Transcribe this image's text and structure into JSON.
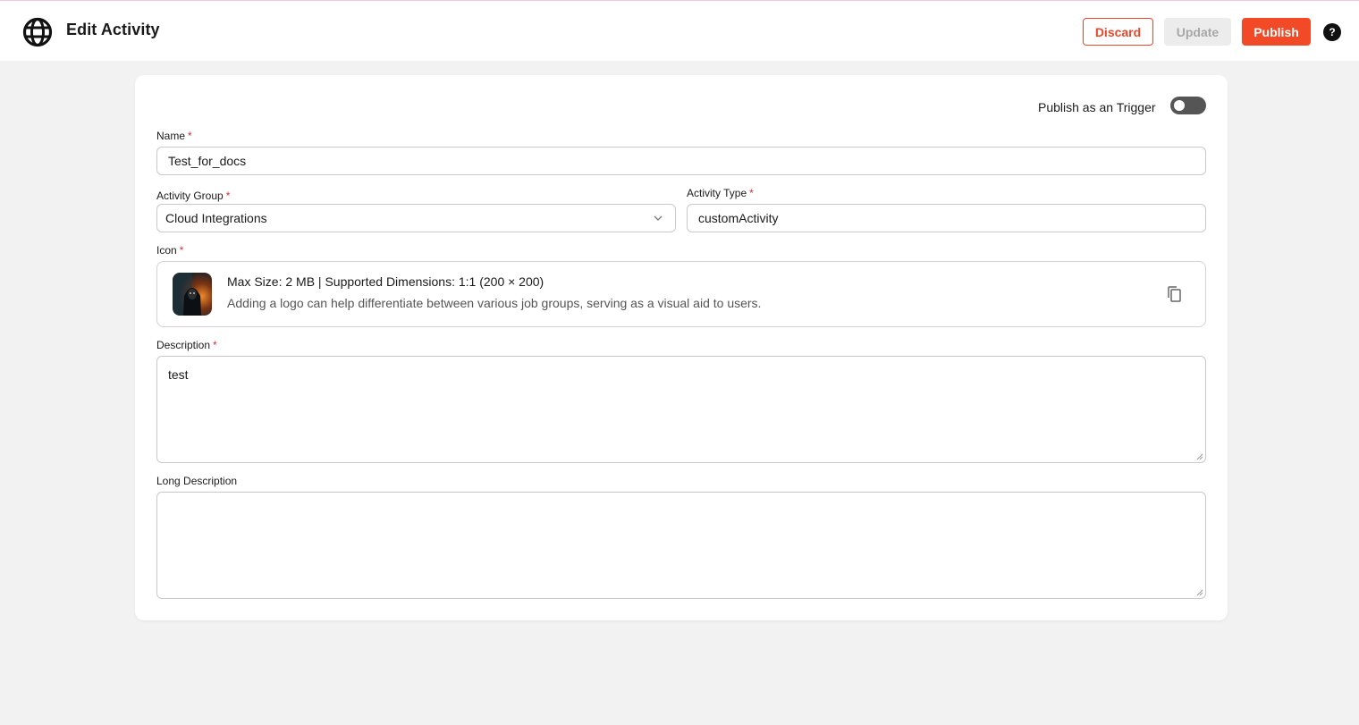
{
  "header": {
    "title": "Edit Activity",
    "discard_label": "Discard",
    "update_label": "Update",
    "publish_label": "Publish",
    "help_symbol": "?"
  },
  "form": {
    "trigger_toggle": {
      "label": "Publish as an Trigger",
      "on": false
    },
    "name": {
      "label": "Name",
      "required_mark": "*",
      "value": "Test_for_docs"
    },
    "activity_group": {
      "label": "Activity Group",
      "required_mark": "*",
      "value": "Cloud Integrations"
    },
    "activity_type": {
      "label": "Activity Type",
      "required_mark": "*",
      "value": "customActivity"
    },
    "icon": {
      "label": "Icon",
      "required_mark": "*",
      "info_line": "Max Size: 2 MB | Supported Dimensions: 1:1 (200 × 200)",
      "help_line": "Adding a logo can help differentiate between various job groups, serving as a visual aid to users."
    },
    "description": {
      "label": "Description",
      "required_mark": "*",
      "value": "test"
    },
    "long_description": {
      "label": "Long Description",
      "value": ""
    }
  },
  "colors": {
    "accent": "#f24a26",
    "discard_border": "#e8472b",
    "disabled_text": "#a7a7a7",
    "toggle_off": "#555555",
    "background": "#f2f2f2"
  },
  "icons": [
    "globe-icon",
    "help-icon",
    "chevron-down-icon",
    "copy-icon",
    "resize-handle-icon"
  ]
}
